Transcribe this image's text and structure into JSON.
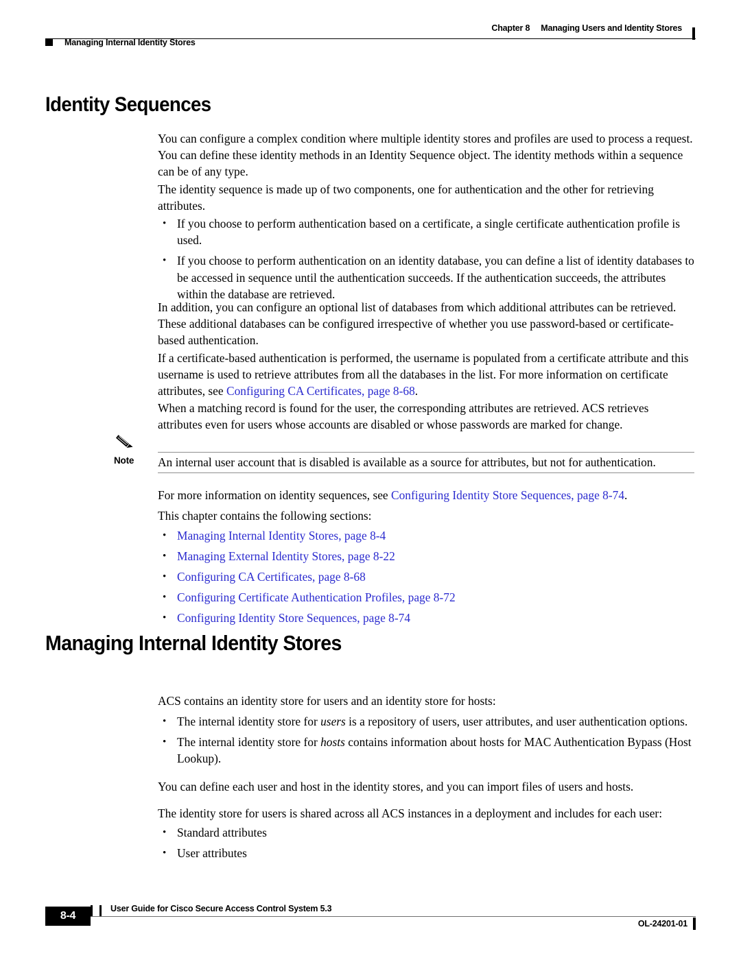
{
  "header": {
    "chapter_label": "Chapter 8",
    "chapter_title": "Managing Users and Identity Stores",
    "section_title": "Managing Internal Identity Stores"
  },
  "headings": {
    "identity_sequences": "Identity Sequences",
    "managing_internal_identity_stores": "Managing Internal Identity Stores"
  },
  "identity_sequences": {
    "para1": "You can configure a complex condition where multiple identity stores and profiles are used to process a request. You can define these identity methods in an Identity Sequence object. The identity methods within a sequence can be of any type.",
    "para2": "The identity sequence is made up of two components, one for authentication and the other for retrieving attributes.",
    "bullet1": "If you choose to perform authentication based on a certificate, a single certificate authentication profile is used.",
    "bullet2": "If you choose to perform authentication on an identity database, you can define a list of identity databases to be accessed in sequence until the authentication succeeds. If the authentication succeeds, the attributes within the database are retrieved.",
    "para3": "In addition, you can configure an optional list of databases from which additional attributes can be retrieved. These additional databases can be configured irrespective of whether you use password-based or certificate-based authentication.",
    "para4_before_link": "If a certificate-based authentication is performed, the username is populated from a certificate attribute and this username is used to retrieve attributes from all the databases in the list. For more information on certificate attributes, see ",
    "para4_link": "Configuring CA Certificates, page 8-68",
    "para4_after_link": ".",
    "para5": "When a matching record is found for the user, the corresponding attributes are retrieved. ACS retrieves attributes even for users whose accounts are disabled or whose passwords are marked for change."
  },
  "note": {
    "label": "Note",
    "icon": "pencil-icon",
    "text": "An internal user account that is disabled is available as a source for attributes, but not for authentication."
  },
  "after_note": {
    "para_before_link": "For more information on identity sequences, see ",
    "para_link": "Configuring Identity Store Sequences, page 8-74",
    "para_after_link": ".",
    "intro": "This chapter contains the following sections:",
    "links": [
      "Managing Internal Identity Stores, page 8-4",
      "Managing External Identity Stores, page 8-22",
      "Configuring CA Certificates, page 8-68",
      "Configuring Certificate Authentication Profiles, page 8-72",
      "Configuring Identity Store Sequences, page 8-74"
    ]
  },
  "managing_internal": {
    "para1": "ACS contains an identity store for users and an identity store for hosts:",
    "bullet1_a": "The internal identity store for ",
    "bullet1_em": "users",
    "bullet1_b": " is a repository of users, user attributes, and user authentication options.",
    "bullet2_a": "The internal identity store for ",
    "bullet2_em": "hosts",
    "bullet2_b": " contains information about hosts for MAC Authentication Bypass (Host Lookup).",
    "para2": "You can define each user and host in the identity stores, and you can import files of users and hosts.",
    "para3": "The identity store for users is shared across all ACS instances in a deployment and includes for each user:",
    "bullet3": "Standard attributes",
    "bullet4": "User attributes"
  },
  "footer": {
    "page_number": "8-4",
    "guide_title": "User Guide for Cisco Secure Access Control System 5.3",
    "doc_id": "OL-24201-01"
  },
  "colors": {
    "link": "#2b2bcf",
    "text": "#000000",
    "rule": "#8e8e8e",
    "page_background": "#ffffff"
  },
  "bullet_glyph": "•"
}
